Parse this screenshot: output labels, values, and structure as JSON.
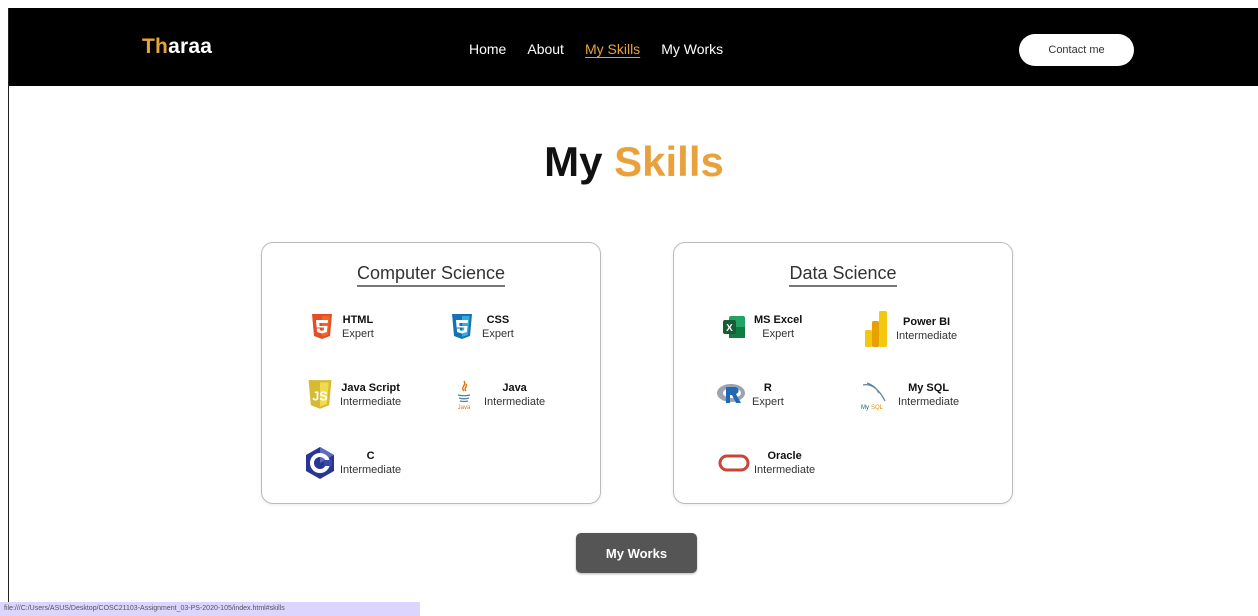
{
  "nav": {
    "brand_part1": "Th",
    "brand_part2": "araa",
    "links": [
      {
        "label": "Home"
      },
      {
        "label": "About"
      },
      {
        "label": "My Skills"
      },
      {
        "label": "My Works"
      }
    ],
    "contact_label": "Contact me"
  },
  "title": {
    "part1": "My",
    "part2": "Skills"
  },
  "sections": [
    {
      "title": "Computer Science",
      "skills": [
        {
          "name": "HTML",
          "level": "Expert",
          "icon": "html5-icon"
        },
        {
          "name": "CSS",
          "level": "Expert",
          "icon": "css3-icon"
        },
        {
          "name": "Java Script",
          "level": "Intermediate",
          "icon": "javascript-icon"
        },
        {
          "name": "Java",
          "level": "Intermediate",
          "icon": "java-icon"
        },
        {
          "name": "C",
          "level": "Intermediate",
          "icon": "c-language-icon"
        }
      ]
    },
    {
      "title": "Data Science",
      "skills": [
        {
          "name": "MS Excel",
          "level": "Expert",
          "icon": "excel-icon"
        },
        {
          "name": "Power BI",
          "level": "Intermediate",
          "icon": "power-bi-icon"
        },
        {
          "name": "R",
          "level": "Expert",
          "icon": "r-language-icon"
        },
        {
          "name": "My SQL",
          "level": "Intermediate",
          "icon": "mysql-icon"
        },
        {
          "name": "Oracle",
          "level": "Intermediate",
          "icon": "oracle-icon"
        }
      ]
    }
  ],
  "works_button": "My Works",
  "status_url": "file:///C:/Users/ASUS/Desktop/COSC21103-Assignment_03-PS-2020-105/index.html#skills",
  "colors": {
    "accent": "#e9a23b",
    "navbar": "#000000",
    "button": "#555555"
  }
}
